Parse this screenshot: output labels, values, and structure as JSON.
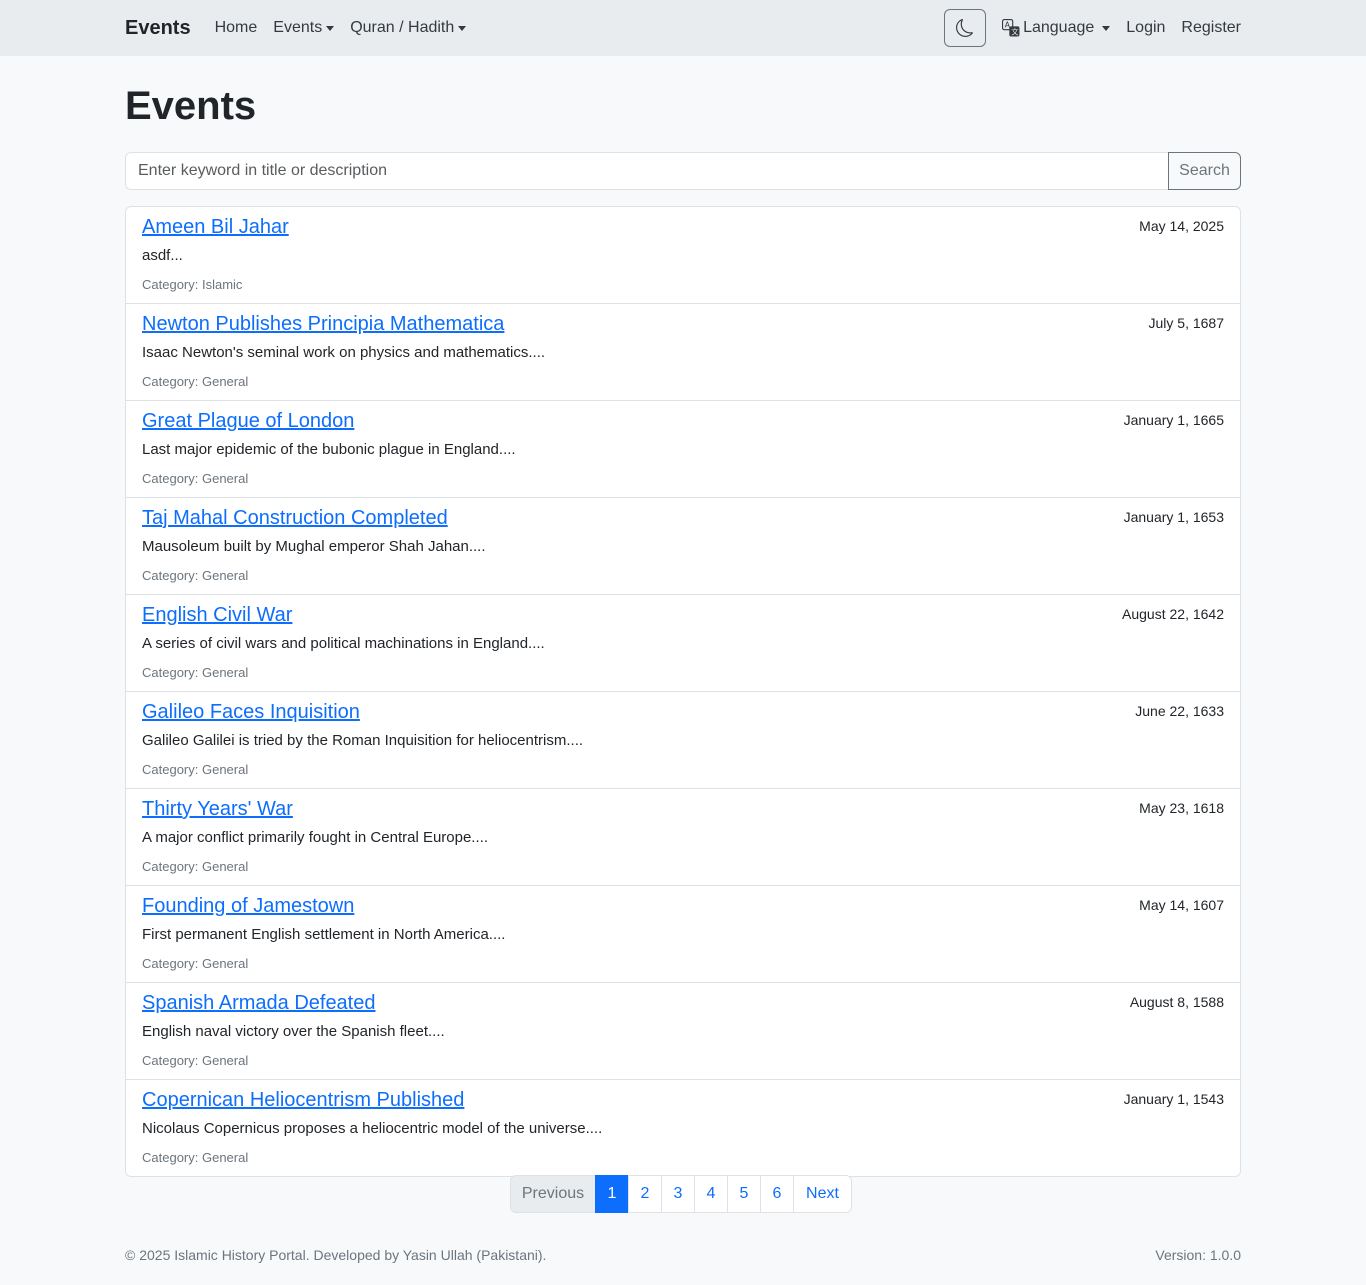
{
  "navbar": {
    "brand": "Events",
    "links": [
      "Home",
      "Events",
      "Quran / Hadith"
    ],
    "language": "Language",
    "login": "Login",
    "register": "Register"
  },
  "page": {
    "title": "Events"
  },
  "search": {
    "placeholder": "Enter keyword in title or description",
    "button": "Search"
  },
  "events": [
    {
      "title": "Ameen Bil Jahar",
      "date": "May 14, 2025",
      "desc": "asdf...",
      "category": "Category: Islamic"
    },
    {
      "title": "Newton Publishes Principia Mathematica",
      "date": "July 5, 1687",
      "desc": "Isaac Newton's seminal work on physics and mathematics....",
      "category": "Category: General"
    },
    {
      "title": "Great Plague of London",
      "date": "January 1, 1665",
      "desc": "Last major epidemic of the bubonic plague in England....",
      "category": "Category: General"
    },
    {
      "title": "Taj Mahal Construction Completed",
      "date": "January 1, 1653",
      "desc": "Mausoleum built by Mughal emperor Shah Jahan....",
      "category": "Category: General"
    },
    {
      "title": "English Civil War",
      "date": "August 22, 1642",
      "desc": "A series of civil wars and political machinations in England....",
      "category": "Category: General"
    },
    {
      "title": "Galileo Faces Inquisition",
      "date": "June 22, 1633",
      "desc": "Galileo Galilei is tried by the Roman Inquisition for heliocentrism....",
      "category": "Category: General"
    },
    {
      "title": "Thirty Years' War",
      "date": "May 23, 1618",
      "desc": "A major conflict primarily fought in Central Europe....",
      "category": "Category: General"
    },
    {
      "title": "Founding of Jamestown",
      "date": "May 14, 1607",
      "desc": "First permanent English settlement in North America....",
      "category": "Category: General"
    },
    {
      "title": "Spanish Armada Defeated",
      "date": "August 8, 1588",
      "desc": "English naval victory over the Spanish fleet....",
      "category": "Category: General"
    },
    {
      "title": "Copernican Heliocentrism Published",
      "date": "January 1, 1543",
      "desc": "Nicolaus Copernicus proposes a heliocentric model of the universe....",
      "category": "Category: General"
    }
  ],
  "pagination": {
    "previous": "Previous",
    "pages": [
      "1",
      "2",
      "3",
      "4",
      "5",
      "6"
    ],
    "next": "Next",
    "active": "1"
  },
  "footer": {
    "copyright": "© 2025 Islamic History Portal. Developed by Yasin Ullah (Pakistani).",
    "version": "Version: 1.0.0"
  },
  "colors": {
    "accent": "#0d6efd",
    "navbar_bg": "#e9ecef",
    "page_bg": "#f8f9fa"
  }
}
